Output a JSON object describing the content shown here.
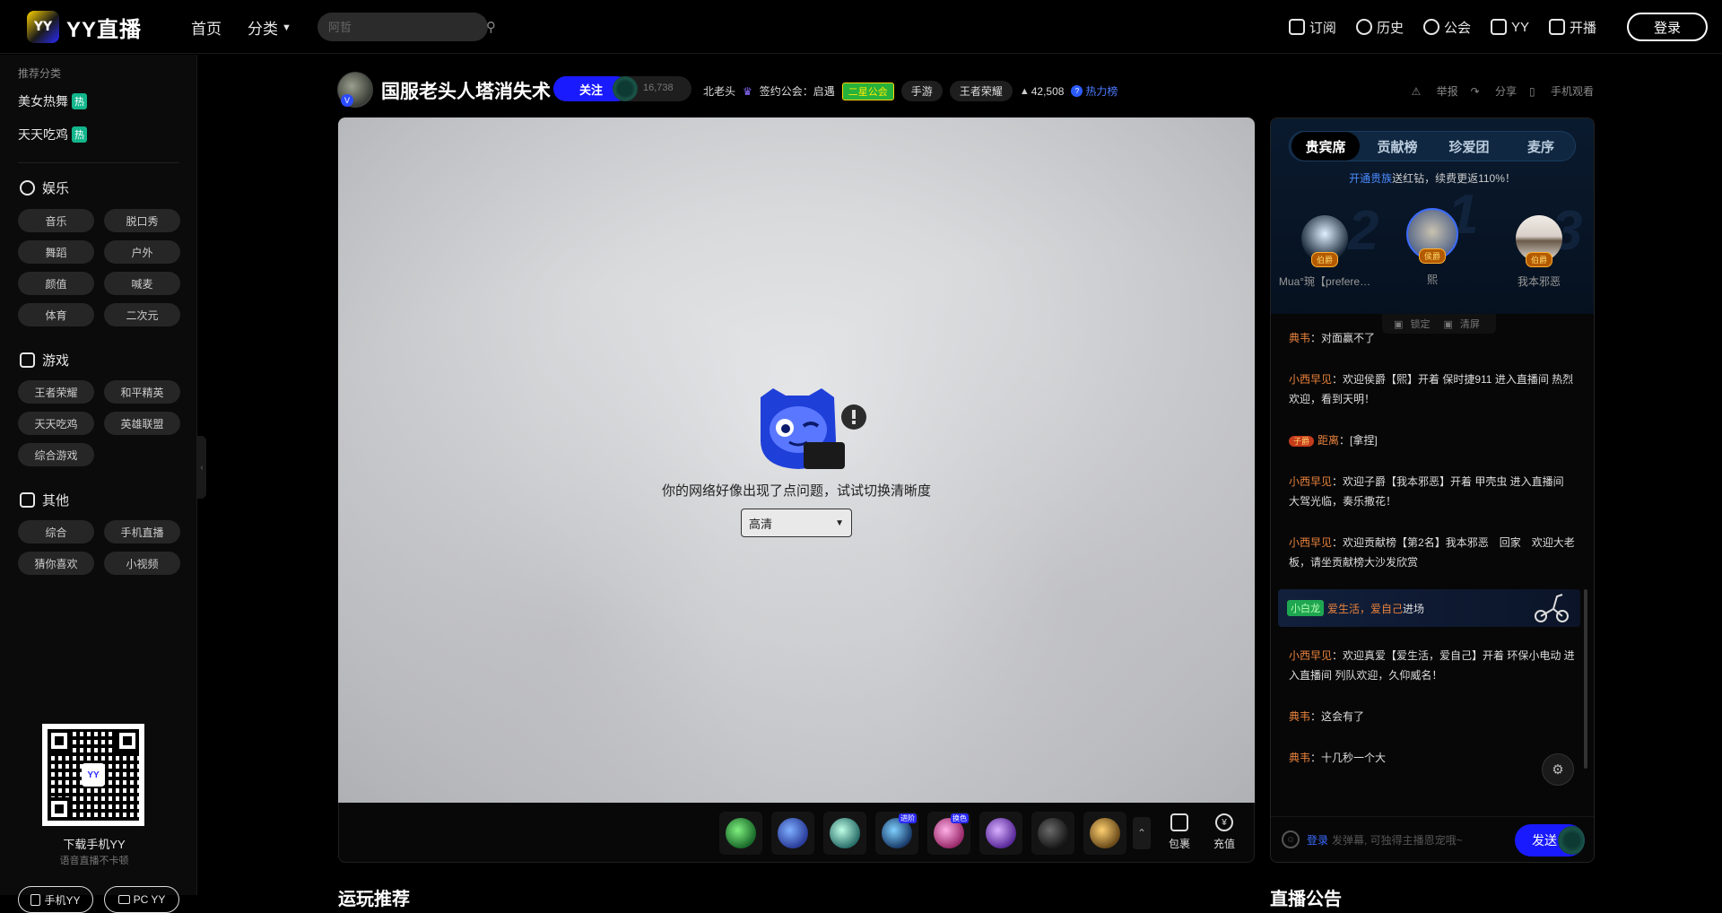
{
  "header": {
    "logo_mark": "YY",
    "logo_text": "YY直播",
    "nav_home": "首页",
    "nav_category": "分类",
    "search_placeholder": "阿哲",
    "actions": [
      {
        "label": "订阅",
        "icon": "bookmark-icon"
      },
      {
        "label": "历史",
        "icon": "clock-icon"
      },
      {
        "label": "公会",
        "icon": "shield-icon"
      },
      {
        "label": "YY",
        "icon": "yy-icon"
      },
      {
        "label": "开播",
        "icon": "camera-icon"
      }
    ],
    "login": "登录"
  },
  "sidebar": {
    "recommend_title": "推荐分类",
    "recommend": [
      {
        "label": "美女热舞",
        "hot": "热"
      },
      {
        "label": "天天吃鸡",
        "hot": "热"
      }
    ],
    "sections": [
      {
        "title": "娱乐",
        "items": [
          "音乐",
          "脱口秀",
          "舞蹈",
          "户外",
          "颜值",
          "喊麦",
          "体育",
          "二次元"
        ]
      },
      {
        "title": "游戏",
        "items": [
          "王者荣耀",
          "和平精英",
          "天天吃鸡",
          "英雄联盟",
          "综合游戏"
        ]
      },
      {
        "title": "其他",
        "items": [
          "综合",
          "手机直播",
          "猜你喜欢",
          "小视频"
        ]
      }
    ],
    "download_title": "下载手机YY",
    "download_sub": "语音直播不卡顿",
    "btn_mobile": "手机YY",
    "btn_pc": "PC YY",
    "qr_center": "YY"
  },
  "room": {
    "title": "国服老头人塔消失术",
    "follow": "关注",
    "follow_count": "16,738",
    "streamer": "北老头",
    "contract": "签约公会：启遇",
    "guild_tag": "二星公会",
    "tag1": "手游",
    "tag2": "王者荣耀",
    "heat": "42,508",
    "hot_rank": "热力榜",
    "actions": [
      "举报",
      "分享",
      "手机观看"
    ]
  },
  "player": {
    "error_text": "你的网络好像出现了点问题，试试切换清晰度",
    "quality": "高清"
  },
  "gifts": {
    "tags": [
      "",
      "",
      "",
      "进阶",
      "换色",
      "",
      "",
      ""
    ],
    "pack": "包裹",
    "recharge": "充值"
  },
  "panel": {
    "tabs": [
      "贵宾席",
      "贡献榜",
      "珍爱团",
      "麦序"
    ],
    "tip_link": "开通贵族",
    "tip_text": "送红钻，续费更返110%！",
    "seats": [
      {
        "name": "Mua°琬【prefere…",
        "rank": "伯爵"
      },
      {
        "name": "熙",
        "rank": "侯爵"
      },
      {
        "name": "我本邪恶",
        "rank": "伯爵"
      }
    ],
    "big_nums": [
      "2",
      "1",
      "3"
    ],
    "lock": "锁定",
    "clear": "清屏"
  },
  "chat": [
    {
      "user": "典韦",
      "text": "：对面赢不了"
    },
    {
      "user": "小西早见",
      "text": "：欢迎侯爵【熙】开着 保时捷911 进入直播间 热烈欢迎，看到天明！"
    },
    {
      "badge": "子爵",
      "user": "距离",
      "text": "：[拿捏]"
    },
    {
      "user": "小西早见",
      "text": "：欢迎子爵【我本邪恶】开着 甲壳虫 进入直播间 大驾光临，奏乐撒花！"
    },
    {
      "user": "小西早见",
      "text": "：欢迎贡献榜【第2名】我本邪恶　回家　欢迎大老板，请坐贡献榜大沙发欣赏"
    },
    {
      "user": "小西早见",
      "text": "：欢迎真爱【爱生活，爱自己】开着 环保小电动 进入直播间 列队欢迎，久仰威名！"
    },
    {
      "user": "典韦",
      "text": "：这会有了"
    },
    {
      "user": "典韦",
      "text": "：十几秒一个大"
    }
  ],
  "enter_bar": {
    "level": "小白龙",
    "name": "爱生活，爱自己",
    "text": "进场"
  },
  "input": {
    "login": "登录",
    "placeholder": "发弹幕, 可独得主播恩宠哦~",
    "send": "发送"
  },
  "bottom": {
    "left_title": "运玩推荐",
    "right_title": "直播公告"
  }
}
